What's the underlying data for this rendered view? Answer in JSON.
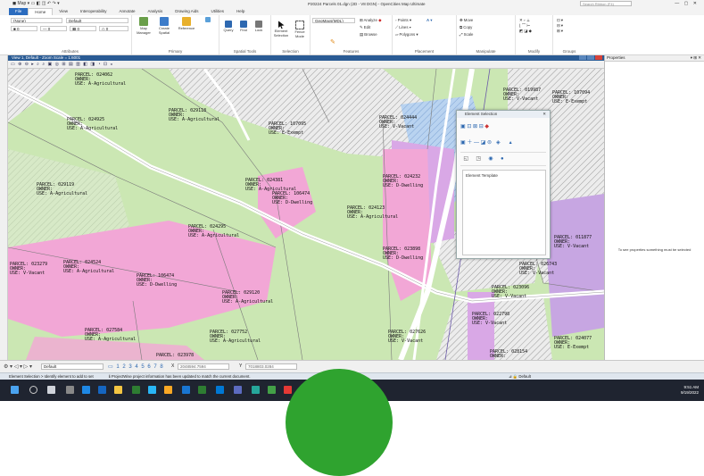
{
  "app": {
    "window_title": "P20224 Parcels 01.dgn (2D - V8 DGN) - OpenCities Map Ultimate",
    "search_placeholder": "Search Ribbon (F4)",
    "qat_label": "Map"
  },
  "ribbon": {
    "tabs": [
      "File",
      "Home",
      "View",
      "Interoperability",
      "Annotate",
      "Analysis",
      "Drawing Aids",
      "Utilities",
      "Help"
    ],
    "active_tab": "Home",
    "attributes": {
      "level_value": "(None)",
      "style_value": "Default",
      "group_label": "Attributes"
    },
    "primary": {
      "map_manager": "Map Manager",
      "create_spatial": "Create Spatial",
      "reference": "Reference",
      "group_label": "Primary"
    },
    "spatial_tools": {
      "query": "Query",
      "find": "Find",
      "lock": "Lock",
      "group_label": "Spatial Tools"
    },
    "selection": {
      "element_selection": "Element Selection",
      "fence_mode": "Fence Mode",
      "group_label": "Selection"
    },
    "features": {
      "feature_dropdown": "GeoMaxs(MDL)",
      "analyze": "Analyze",
      "edit": "Edit",
      "browse": "Browse",
      "group_label": "Features"
    },
    "placement": {
      "points": "Points",
      "lines": "Lines",
      "polygons": "Polygons",
      "text": "Text",
      "group_label": "Placement"
    },
    "manipulate": {
      "move": "Move",
      "copy": "Copy",
      "scale": "Scale",
      "group_label": "Manipulate"
    },
    "modify": {
      "group_label": "Modify"
    },
    "groups": {
      "group_label": "Groups"
    }
  },
  "view": {
    "title": "View 1, Default - Zoom Scale = 1:6001"
  },
  "parcels": [
    {
      "line1": "PARCEL: 024062",
      "line2": "OWNER:",
      "line3": "USE: A-Agricultural"
    },
    {
      "line1": "PARCEL: 029118",
      "line2": "OWNER:",
      "line3": "USE: A-Agricultural"
    },
    {
      "line1": "PARCEL: 024925",
      "line2": "OWNER:",
      "line3": "USE: A-Agricultural"
    },
    {
      "line1": "PARCEL: 107095",
      "line2": "OWNER:",
      "line3": "USE: E-Exempt"
    },
    {
      "line1": "PARCEL: 024444",
      "line2": "OWNER:",
      "line3": "USE: V-Vacant"
    },
    {
      "line1": "PARCEL: 019987",
      "line2": "OWNER:",
      "line3": "USE: V-Vacant"
    },
    {
      "line1": "PARCEL: 107094",
      "line2": "OWNER:",
      "line3": "USE: E-Exempt"
    },
    {
      "line1": "PARCEL: 029119",
      "line2": "OWNER:",
      "line3": "USE: A-Agricultural"
    },
    {
      "line1": "PARCEL: 024381",
      "line2": "OWNER:",
      "line3": "USE: A-Agricultural"
    },
    {
      "line1": "PARCEL: 106474",
      "line2": "OWNER:",
      "line3": "USE: D-Dwelling"
    },
    {
      "line1": "PARCEL: 024123",
      "line2": "OWNER:",
      "line3": "USE: A-Agricultural"
    },
    {
      "line1": "PARCEL: 024232",
      "line2": "OWNER:",
      "line3": "USE: D-Dwelling"
    },
    {
      "line1": "PARCEL: 024295",
      "line2": "OWNER:",
      "line3": "USE: A-Agricultural"
    },
    {
      "line1": "PARCEL: 023279",
      "line2": "OWNER:",
      "line3": "USE: V-Vacant"
    },
    {
      "line1": "PARCEL: 024524",
      "line2": "OWNER:",
      "line3": "USE: A-Agricultural"
    },
    {
      "line1": "PARCEL: 106474",
      "line2": "OWNER:",
      "line3": "USE: D-Dwelling"
    },
    {
      "line1": "PARCEL: 029120",
      "line2": "OWNER:",
      "line3": "USE: A-Agricultural"
    },
    {
      "line1": "PARCEL: 023898",
      "line2": "OWNER:",
      "line3": "USE: D-Dwelling"
    },
    {
      "line1": "PARCEL: 026743",
      "line2": "OWNER:",
      "line3": "USE: V-Vacant"
    },
    {
      "line1": "PARCEL: 023096",
      "line2": "OWNER:",
      "line3": "USE: V-Vacant"
    },
    {
      "line1": "PARCEL: 027584",
      "line2": "OWNER:",
      "line3": "USE: A-Agricultural"
    },
    {
      "line1": "PARCEL: 027752",
      "line2": "OWNER:",
      "line3": "USE: A-Agricultural"
    },
    {
      "line1": "PARCEL: 027626",
      "line2": "OWNER:",
      "line3": "USE: V-Vacant"
    },
    {
      "line1": "PARCEL: 022798",
      "line2": "OWNER:",
      "line3": "USE: V-Vacant"
    },
    {
      "line1": "PARCEL: 023978",
      "line2": "OWNER:",
      "line3": "USE: A-Agricultural"
    },
    {
      "line1": "PARCEL: 028154",
      "line2": "OWNER:",
      "line3": "USE: V-Vacant"
    },
    {
      "line1": "PARCEL: 011877",
      "line2": "OWNER:",
      "line3": "USE: V-Vacant"
    },
    {
      "line1": "PARCEL: 024077",
      "line2": "OWNER:",
      "line3": "USE: E-Exempt"
    }
  ],
  "element_selection": {
    "title": "Element Selection",
    "template_label": "Element Template"
  },
  "properties": {
    "title": "Properties",
    "message": "To see properties something must be selected"
  },
  "statusbar": {
    "model": "Default",
    "x_label": "X",
    "x_value": "2048594.7594",
    "y_label": "Y",
    "y_value": "7018803.0284",
    "prompt": "Element Selection > Identify element to add to set",
    "info": "ProjectWise project information has been updated to match the current document.",
    "right_model": "Default"
  },
  "taskbar": {
    "time": "9:51 AM",
    "date": "9/19/2022"
  },
  "colors": {
    "agricultural": "#cbe7b3",
    "dwelling": "#f2a7d6",
    "vacant_purple": "#d9a8e6",
    "water_blue": "#aac8ea",
    "road": "#ffffff",
    "title_blue": "#2a5b94",
    "circle_green": "#2fa32f"
  }
}
